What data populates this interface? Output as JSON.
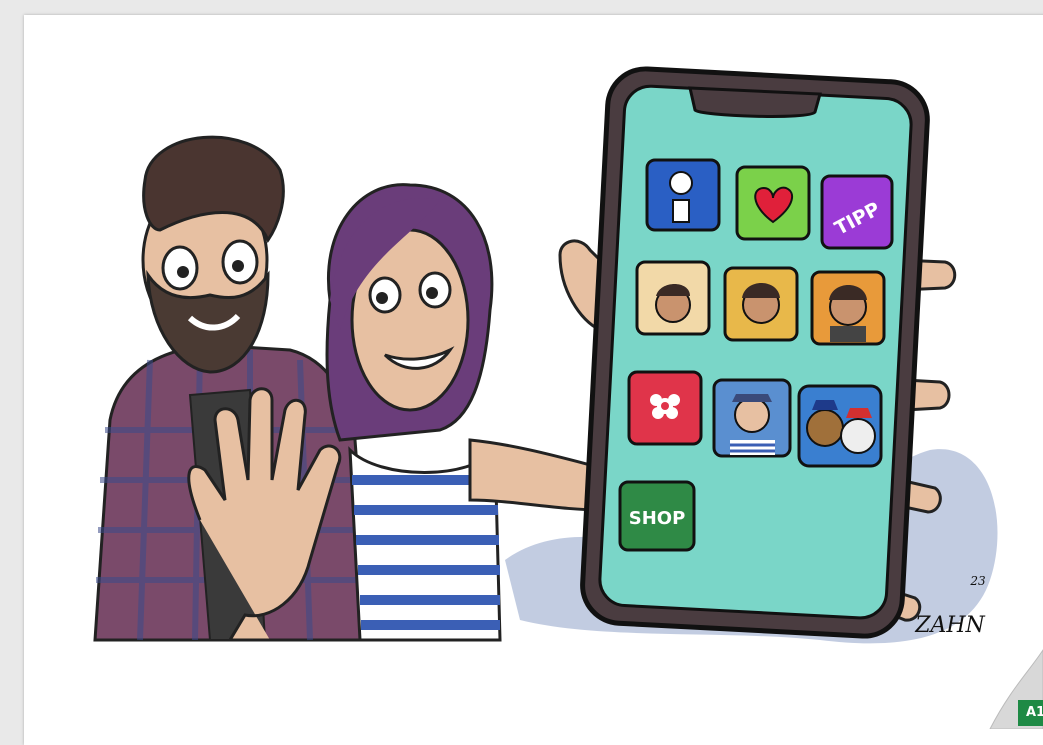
{
  "illustration": {
    "phone": {
      "apps": [
        {
          "id": "baby-info",
          "label": "",
          "color": "#2a5fc4"
        },
        {
          "id": "heart",
          "label": "",
          "color": "#7bd14a"
        },
        {
          "id": "tipp",
          "label": "TIPP",
          "color": "#9b3bd6"
        },
        {
          "id": "child-1",
          "label": "",
          "color": "#f2d9a8"
        },
        {
          "id": "child-2",
          "label": "",
          "color": "#e8b84a"
        },
        {
          "id": "child-3",
          "label": "",
          "color": "#e89a3a"
        },
        {
          "id": "album",
          "label": "",
          "color": "#e0344a"
        },
        {
          "id": "sailor",
          "label": "",
          "color": "#5a8fd0"
        },
        {
          "id": "paw-patrol",
          "label": "",
          "color": "#3a7fd0"
        },
        {
          "id": "shop",
          "label": "SHOP",
          "color": "#2f8a46"
        }
      ],
      "screen_color": "#7ad6c8"
    },
    "signature": "ZAHN",
    "signature_year": "23"
  },
  "corner_badge": {
    "label": "A1",
    "color": "#1e8a45"
  }
}
